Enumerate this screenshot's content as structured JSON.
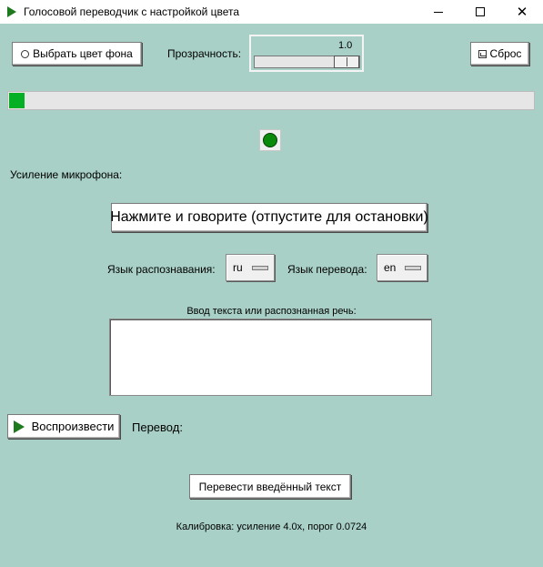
{
  "window": {
    "title": "Голосовой переводчик с настройкой цвета",
    "controls": {
      "minimize": "—",
      "maximize": "☐",
      "close": "✕"
    }
  },
  "toolbar": {
    "choose_color_label": "Выбрать цвет фона",
    "transparency_label": "Прозрачность:",
    "transparency_value": "1.0",
    "reset_label": "Сброс"
  },
  "level_meter": {
    "fill_fraction": 0.03,
    "color": "#06b025"
  },
  "status_indicator": {
    "color": "#0a8a0a"
  },
  "mic_gain_label": "Усиление микрофона:",
  "talk_button_label": "Нажмите и говорите (отпустите для остановки)",
  "languages": {
    "recognition_label": "Язык распознавания:",
    "recognition_value": "ru",
    "translation_label": "Язык перевода:",
    "translation_value": "en"
  },
  "input": {
    "label": "Ввод текста или распознанная речь:",
    "value": ""
  },
  "playback": {
    "play_label": "Воспроизвести",
    "translation_label": "Перевод:"
  },
  "translate_button_label": "Перевести введённый текст",
  "calibration_text": "Калибровка: усиление 4.0x, порог 0.0724",
  "colors": {
    "background": "#a8d0c6",
    "accent": "#1d7a1d"
  }
}
